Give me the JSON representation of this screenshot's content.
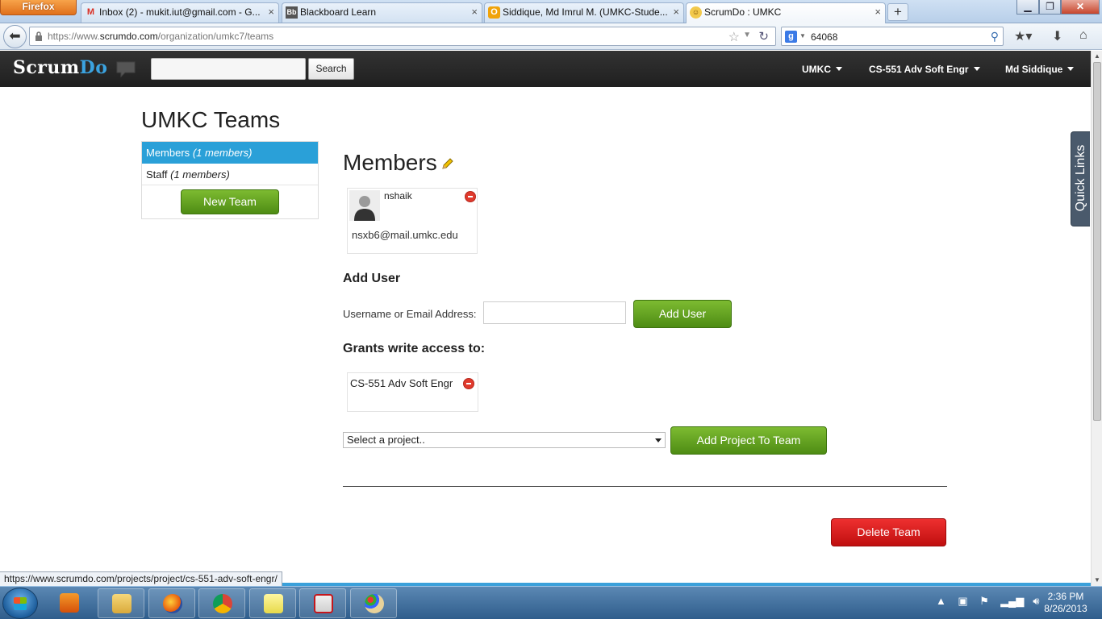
{
  "browser": {
    "menu_button": "Firefox",
    "tabs": [
      {
        "title": "Inbox (2) - mukit.iut@gmail.com - G...",
        "favicon": "gmail-icon"
      },
      {
        "title": "Blackboard Learn",
        "favicon": "blackboard-icon"
      },
      {
        "title": "Siddique, Md Imrul M. (UMKC-Stude...",
        "favicon": "outlook-icon"
      },
      {
        "title": "ScrumDo : UMKC",
        "favicon": "scrumdo-icon"
      }
    ],
    "url_prefix": "https://www.",
    "url_domain": "scrumdo.com",
    "url_path": "/organization/umkc7/teams",
    "search_engine": "google-icon",
    "search_value": "64068"
  },
  "topbar": {
    "logo_part1": "Scrum",
    "logo_part2": "Do",
    "search_button": "Search",
    "search_placeholder": "",
    "org_menu": "UMKC",
    "project_menu": "CS-551 Adv Soft Engr",
    "user_menu": "Md Siddique"
  },
  "page": {
    "title": "UMKC Teams",
    "teams": [
      {
        "name": "Members",
        "count": "(1 members)",
        "selected": true
      },
      {
        "name": "Staff",
        "count": "(1 members)",
        "selected": false
      }
    ],
    "new_team_button": "New Team",
    "team_heading": "Members",
    "members": [
      {
        "username": "nshaik",
        "email": "nsxb6@mail.umkc.edu"
      }
    ],
    "add_user_heading": "Add User",
    "add_user_label": "Username or Email Address:",
    "add_user_value": "",
    "add_user_button": "Add User",
    "grants_heading": "Grants write access to:",
    "projects": [
      {
        "name": "CS-551 Adv Soft Engr"
      }
    ],
    "project_select_value": "Select a project..",
    "add_project_button": "Add Project To Team",
    "delete_team_button": "Delete Team",
    "quick_links": "Quick Links"
  },
  "status_bar": {
    "hover_url": "https://www.scrumdo.com/projects/project/cs-551-adv-soft-engr/"
  },
  "taskbar": {
    "time": "2:36 PM",
    "date": "8/26/2013"
  },
  "colors": {
    "accent_blue": "#2aa0d8",
    "button_green": "#5e9e1f",
    "button_red": "#d01818",
    "topbar_dark": "#2a2a2a"
  }
}
